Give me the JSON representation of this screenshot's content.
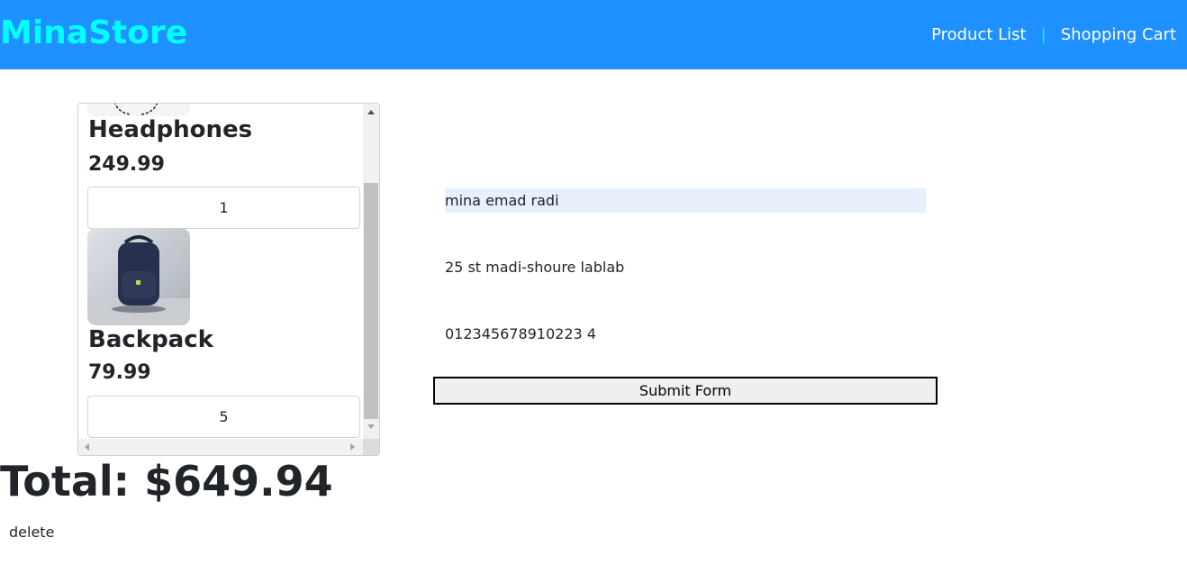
{
  "navbar": {
    "brand": "MinaStore",
    "links": [
      "Product List",
      "Shopping Cart"
    ],
    "separator": "|",
    "bg_color": "#1e90ff",
    "brand_color": "#00ffff"
  },
  "cart": {
    "items": [
      {
        "name": "Headphones",
        "price": "249.99",
        "quantity": "1",
        "image": "headphones-image"
      },
      {
        "name": "Backpack",
        "price": "79.99",
        "quantity": "5",
        "image": "backpack-image"
      }
    ],
    "total_label": "Total: $649.94",
    "delete_label": "delete"
  },
  "form": {
    "name_value": "mina emad radi",
    "address_value": "25 st madi-shoure lablab",
    "phone_value": "012345678910223 4",
    "submit_label": "Submit Form"
  }
}
